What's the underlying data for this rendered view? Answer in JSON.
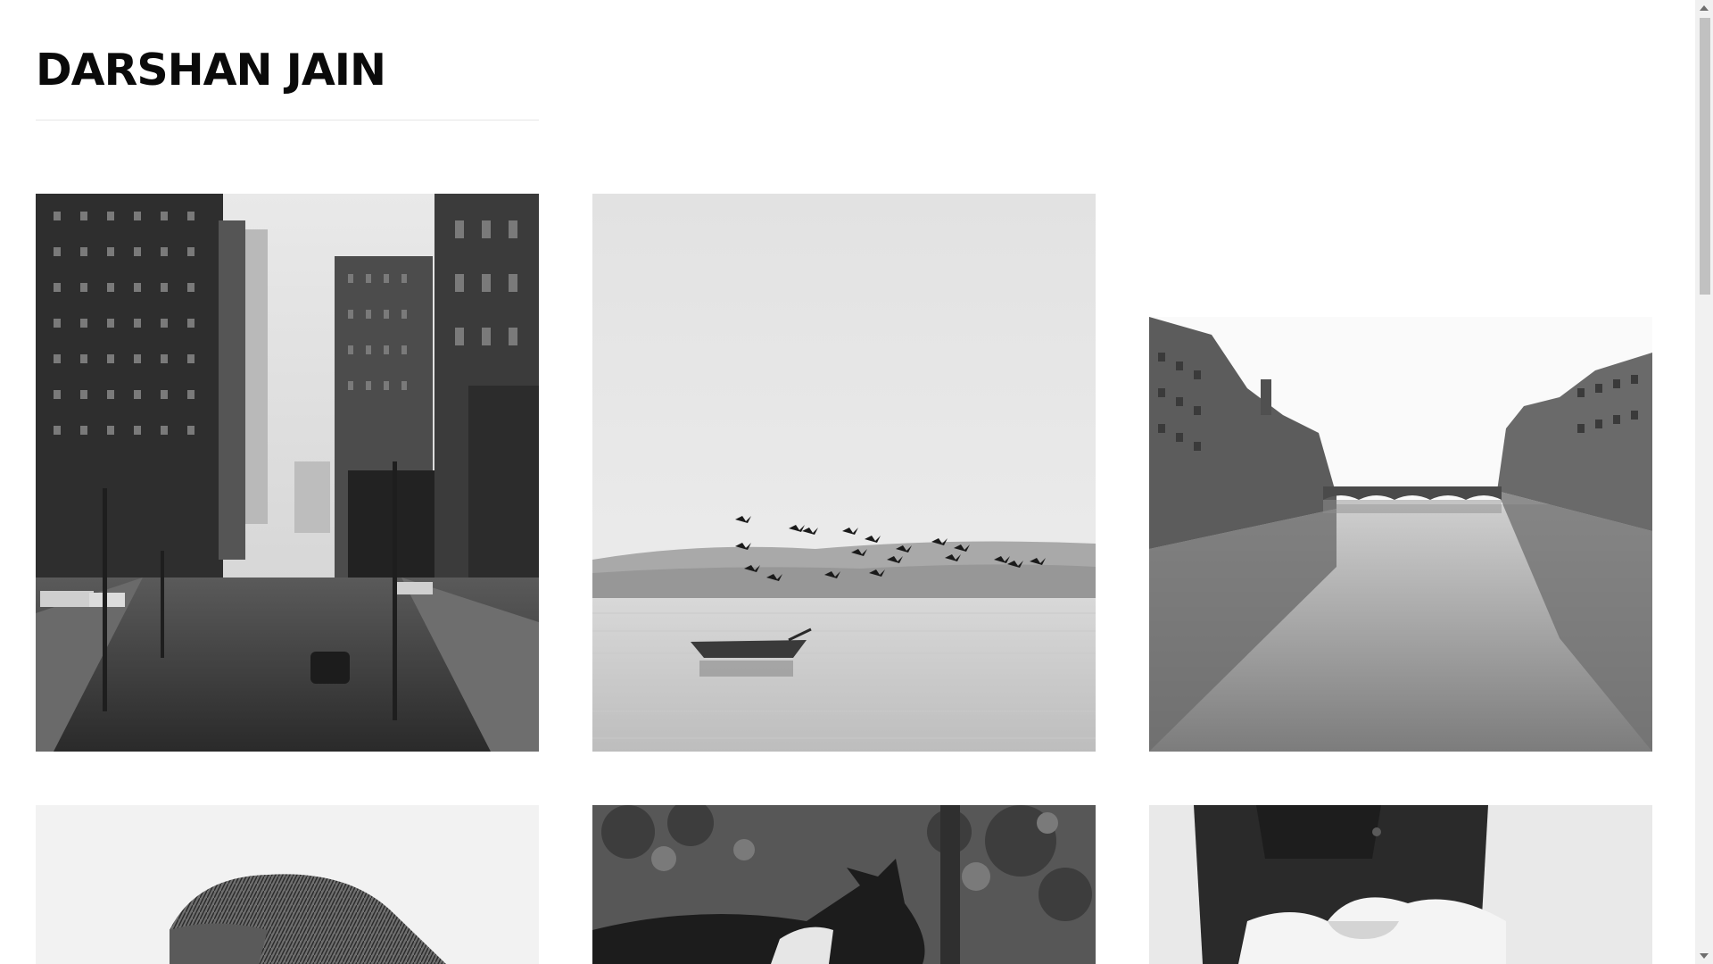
{
  "site": {
    "title": "DARSHAN JAIN"
  },
  "gallery": {
    "items": [
      {
        "subject": "city-street"
      },
      {
        "subject": "lake-boat-birds"
      },
      {
        "subject": "river-bridge"
      },
      {
        "subject": "person-flat-cap"
      },
      {
        "subject": "horse"
      },
      {
        "subject": "person-white-bow"
      }
    ]
  },
  "colors": {
    "background": "#ffffff",
    "title": "#0a0a0a",
    "rule": "#e6e6e6",
    "scrollbar_track": "#f1f1f1",
    "scrollbar_thumb": "#c1c1c1"
  }
}
